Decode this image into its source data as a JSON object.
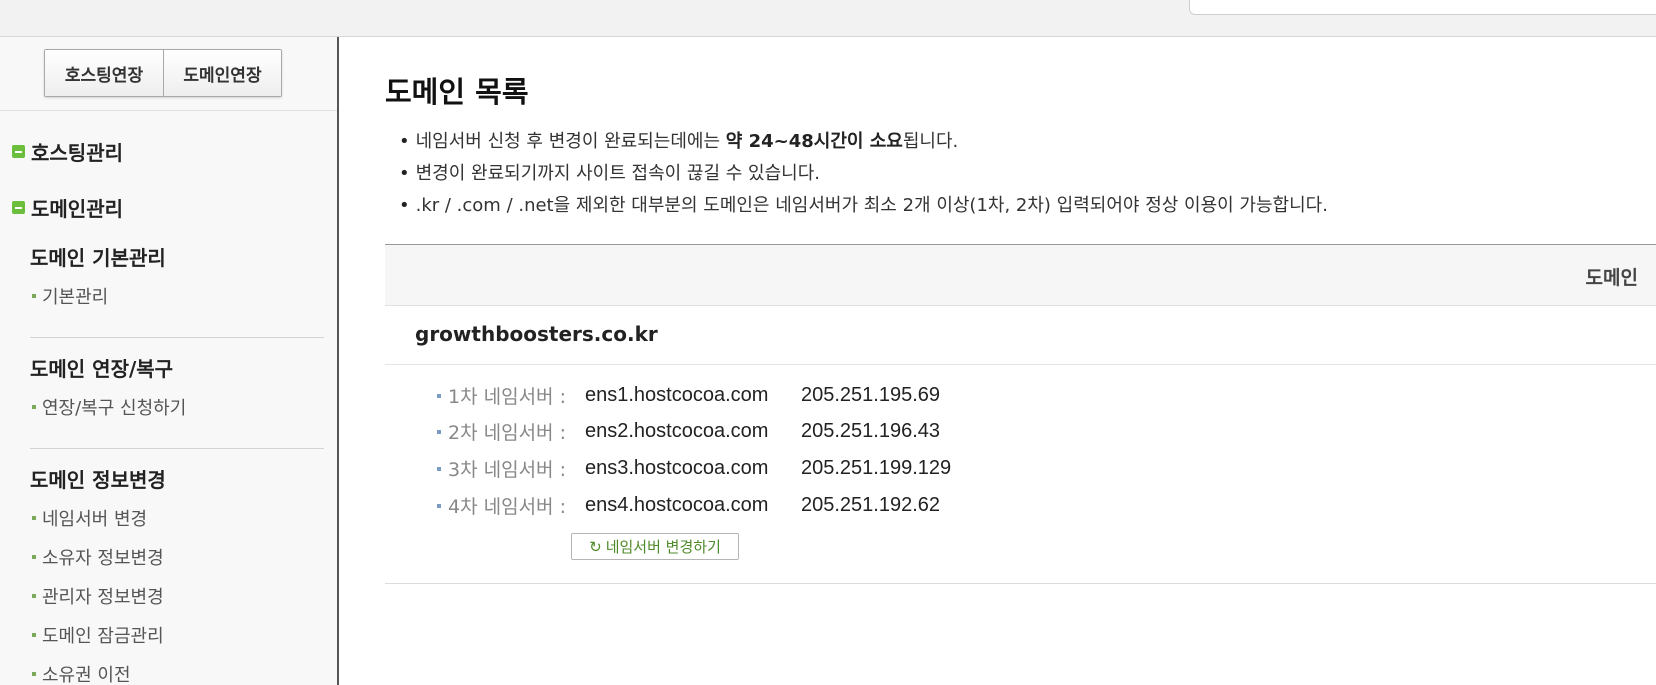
{
  "sidebar": {
    "extend_buttons": {
      "hosting": "호스팅연장",
      "domain": "도메인연장"
    },
    "categories": {
      "hosting": "호스팅관리",
      "domain": "도메인관리"
    },
    "groups": [
      {
        "title": "도메인 기본관리",
        "items": [
          "기본관리"
        ]
      },
      {
        "title": "도메인 연장/복구",
        "items": [
          "연장/복구 신청하기"
        ]
      },
      {
        "title": "도메인 정보변경",
        "items": [
          "네임서버 변경",
          "소유자 정보변경",
          "관리자 정보변경",
          "도메인 잠금관리",
          "소유권 이전"
        ]
      }
    ]
  },
  "main": {
    "title": "도메인 목록",
    "notices": [
      {
        "before": "네임서버 신청 후 변경이 완료되는데에는 ",
        "bold": "약 24~48시간이 소요",
        "after": "됩니다."
      },
      {
        "text": "변경이 완료되기까지 사이트 접속이 끊길 수 있습니다."
      },
      {
        "text": ".kr / .com / .net을 제외한 대부분의 도메인은 네임서버가 최소 2개 이상(1차, 2차) 입력되어야 정상 이용이 가능합니다."
      }
    ],
    "table": {
      "header_domain": "도메인",
      "domain": "growthboosters.co.kr",
      "nameservers": [
        {
          "label": "1차 네임서버 :",
          "host": "ens1.hostcocoa.com",
          "ip": "205.251.195.69"
        },
        {
          "label": "2차 네임서버 :",
          "host": "ens2.hostcocoa.com",
          "ip": "205.251.196.43"
        },
        {
          "label": "3차 네임서버 :",
          "host": "ens3.hostcocoa.com",
          "ip": "205.251.199.129"
        },
        {
          "label": "4차 네임서버 :",
          "host": "ens4.hostcocoa.com",
          "ip": "205.251.192.62"
        }
      ],
      "change_button": "네임서버 변경하기"
    }
  },
  "colors": {
    "category_icon": "#6cbf3c",
    "change_button_text": "#4f8a2a"
  },
  "icons": {
    "category": "minus-square-icon",
    "change": "refresh-icon"
  }
}
